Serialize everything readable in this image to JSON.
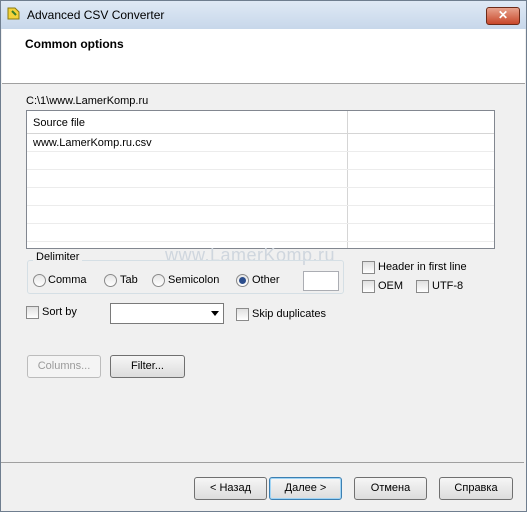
{
  "window": {
    "title": "Advanced CSV Converter"
  },
  "header": {
    "title": "Common options"
  },
  "source": {
    "path": "C:\\1\\www.LamerKomp.ru"
  },
  "grid": {
    "columns": [
      "Source file",
      ""
    ],
    "rows": [
      [
        "www.LamerKomp.ru.csv",
        ""
      ]
    ]
  },
  "watermark": "www.LamerKomp.ru",
  "delimiter": {
    "label": "Delimiter",
    "options": [
      "Comma",
      "Tab",
      "Semicolon",
      "Other"
    ],
    "selected": "Other",
    "other_value": ""
  },
  "checks": {
    "header_first_line": "Header in first line",
    "oem": "OEM",
    "utf8": "UTF-8",
    "sort_by": "Sort by",
    "skip_duplicates": "Skip duplicates"
  },
  "sort": {
    "selected": ""
  },
  "buttons": {
    "columns": "Columns...",
    "filter": "Filter...",
    "back": "< Назад",
    "next": "Далее >",
    "cancel": "Отмена",
    "help": "Справка"
  }
}
